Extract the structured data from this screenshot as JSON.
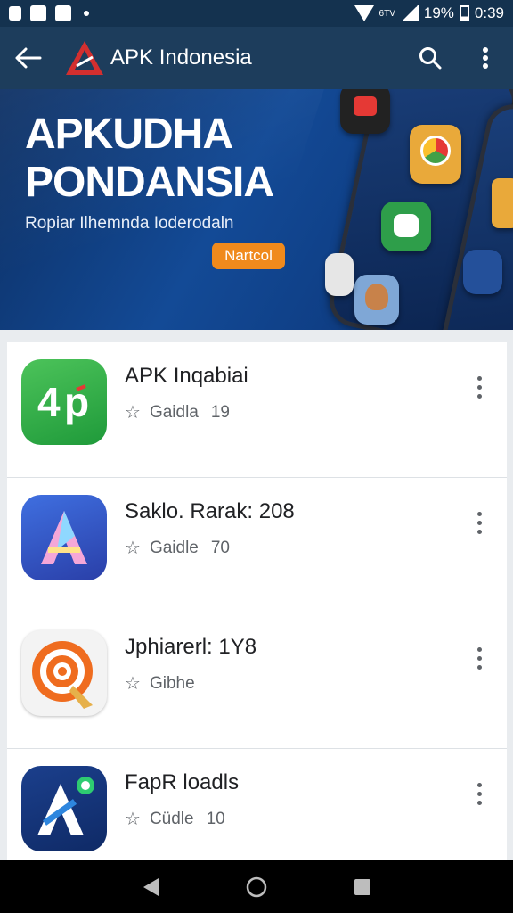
{
  "status_bar": {
    "battery": "19%",
    "time": "0:39",
    "network_label": "6TV"
  },
  "app_bar": {
    "title": "APK Indonesia"
  },
  "banner": {
    "title_line1": "APKUDHA",
    "title_line2": "PONDANSIA",
    "subtitle": "Ropiar Ilhemnda Ioderodaln",
    "button_label": "Nartcol"
  },
  "apps": [
    {
      "name": "APK Inqabiai",
      "meta_label": "Gaidla",
      "count": "19"
    },
    {
      "name": "Saklo. Rarak: 208",
      "meta_label": "Gaidle",
      "count": "70"
    },
    {
      "name": "Jphiarerl: 1Y8",
      "meta_label": "Gibhe",
      "count": ""
    },
    {
      "name": "FapR loadls",
      "meta_label": "Cüdle",
      "count": "10"
    }
  ],
  "colors": {
    "appbar": "#1d3d5c",
    "accent": "#f08a1c",
    "status": "#14324f"
  },
  "icons": [
    "back-arrow-icon",
    "search-icon",
    "more-vert-icon",
    "star-icon",
    "nav-back-icon",
    "nav-home-icon",
    "nav-recents-icon"
  ]
}
